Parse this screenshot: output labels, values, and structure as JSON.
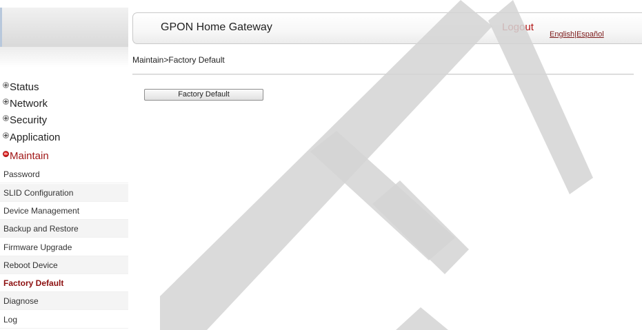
{
  "header": {
    "title": "GPON Home Gateway",
    "logout_label": "Logout",
    "lang_english": "English",
    "lang_separator": "|",
    "lang_spanish": "Español"
  },
  "breadcrumb": "Maintain>Factory Default",
  "main": {
    "factory_default_button": "Factory Default"
  },
  "sidebar": {
    "categories": [
      {
        "label": "Status",
        "expanded": false
      },
      {
        "label": "Network",
        "expanded": false
      },
      {
        "label": "Security",
        "expanded": false
      },
      {
        "label": "Application",
        "expanded": false
      },
      {
        "label": "Maintain",
        "expanded": true
      }
    ],
    "maintain_items": [
      {
        "label": "Password"
      },
      {
        "label": "SLID Configuration"
      },
      {
        "label": "Device Management"
      },
      {
        "label": "Backup and Restore"
      },
      {
        "label": "Firmware Upgrade"
      },
      {
        "label": "Reboot Device"
      },
      {
        "label": "Factory Default",
        "selected": true
      },
      {
        "label": "Diagnose"
      },
      {
        "label": "Log"
      }
    ]
  },
  "icons": {
    "collapsed": "plus-circle-icon",
    "expanded": "minus-circle-icon"
  },
  "colors": {
    "accent_red": "#b21515",
    "selected_item": "#8c0f0f",
    "watermark": "#d4d4d4"
  }
}
